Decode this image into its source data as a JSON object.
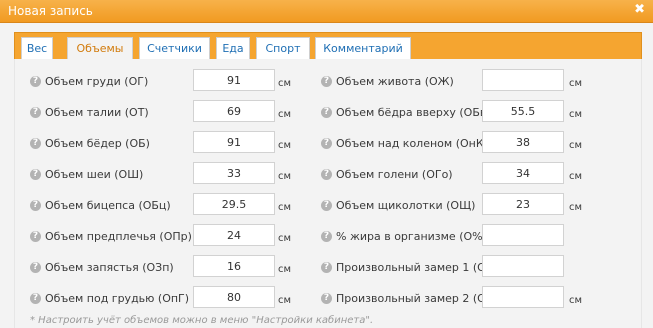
{
  "window": {
    "title": "Новая запись",
    "close_glyph": "✖"
  },
  "tabs": [
    {
      "label": "Вес",
      "active": false
    },
    {
      "label": "Объемы",
      "active": true
    },
    {
      "label": "Счетчики",
      "active": false
    },
    {
      "label": "Еда",
      "active": false
    },
    {
      "label": "Спорт",
      "active": false
    },
    {
      "label": "Комментарий",
      "active": false
    }
  ],
  "unit": "см",
  "help_glyph": "?",
  "left_fields": [
    {
      "label": "Объем груди (ОГ)",
      "value": "91"
    },
    {
      "label": "Объем талии (ОТ)",
      "value": "69"
    },
    {
      "label": "Объем бёдер (ОБ)",
      "value": "91"
    },
    {
      "label": "Объем шеи (ОШ)",
      "value": "33"
    },
    {
      "label": "Объем бицепса (ОБц)",
      "value": "29.5"
    },
    {
      "label": "Объем предплечья (ОПр)",
      "value": "24"
    },
    {
      "label": "Объем запястья (ОЗп)",
      "value": "16"
    },
    {
      "label": "Объем под грудью (ОпГ)",
      "value": "80"
    }
  ],
  "right_fields": [
    {
      "label": "Объем живота (ОЖ)",
      "value": "",
      "unit": "см"
    },
    {
      "label": "Объем бёдра вверху (ОБв)",
      "value": "55.5",
      "unit": "см"
    },
    {
      "label": "Объем над коленом (ОнК)",
      "value": "38",
      "unit": "см"
    },
    {
      "label": "Объем голени (ОГо)",
      "value": "34",
      "unit": "см"
    },
    {
      "label": "Объем щиколотки (ОЩ)",
      "value": "23",
      "unit": "см"
    },
    {
      "label": "% жира в организме (О%)",
      "value": "",
      "unit": ""
    },
    {
      "label": "Произвольный замер 1 (О1)",
      "value": "",
      "unit": ""
    },
    {
      "label": "Произвольный замер 2 (О2)",
      "value": "",
      "unit": "см"
    }
  ],
  "footnote": "* Настроить учёт объемов можно в меню \"Настройки кабинета\".",
  "colors": {
    "title_bar": "#f19a21",
    "tab_bar": "#f5a530",
    "tab_text": "#1f6fb4",
    "active_tab_text": "#d27b0c",
    "panel": "#f3f3f3"
  }
}
